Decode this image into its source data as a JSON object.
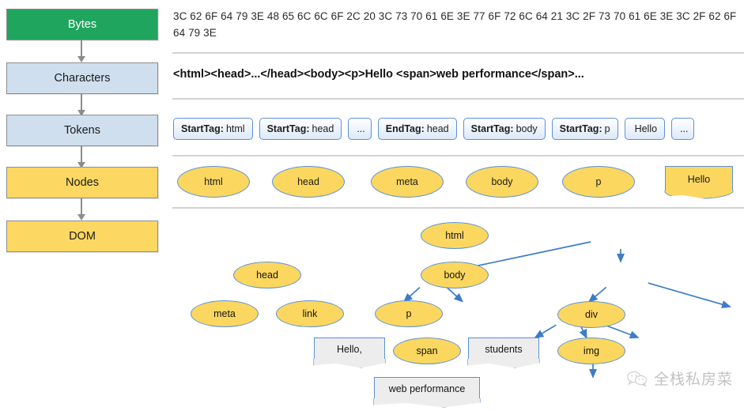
{
  "pipeline": {
    "steps": [
      {
        "label": "Bytes",
        "color": "#1fa55d",
        "style": "green"
      },
      {
        "label": "Characters",
        "color": "#cfdfee",
        "style": "blue"
      },
      {
        "label": "Tokens",
        "color": "#cfdfee",
        "style": "blue"
      },
      {
        "label": "Nodes",
        "color": "#fcd862",
        "style": "yellow"
      },
      {
        "label": "DOM",
        "color": "#fcd862",
        "style": "yellow"
      }
    ]
  },
  "stages": {
    "bytes": {
      "text": "3C 62 6F 64 79 3E 48 65 6C 6C 6F 2C 20 3C 73 70 61 6E 3E 77 6F 72 6C 64 21 3C 2F 73 70 61 6E 3E 3C 2F 62 6F 64 79 3E"
    },
    "characters": {
      "text": "<html><head>...</head><body><p>Hello <span>web performance</span>..."
    },
    "tokens": {
      "items": [
        {
          "key": "StartTag:",
          "value": "html"
        },
        {
          "key": "StartTag:",
          "value": "head"
        },
        {
          "key": "",
          "value": "..."
        },
        {
          "key": "EndTag:",
          "value": "head"
        },
        {
          "key": "StartTag:",
          "value": "body"
        },
        {
          "key": "StartTag:",
          "value": "p"
        },
        {
          "key": "",
          "value": "Hello"
        },
        {
          "key": "",
          "value": "..."
        }
      ]
    },
    "nodes": {
      "items": [
        {
          "label": "html",
          "shape": "ellipse"
        },
        {
          "label": "head",
          "shape": "ellipse"
        },
        {
          "label": "meta",
          "shape": "ellipse"
        },
        {
          "label": "body",
          "shape": "ellipse"
        },
        {
          "label": "p",
          "shape": "ellipse"
        },
        {
          "label": "Hello",
          "shape": "note"
        }
      ]
    },
    "dom_tree": {
      "element_nodes": [
        {
          "id": "html",
          "label": "html"
        },
        {
          "id": "head",
          "label": "head"
        },
        {
          "id": "body",
          "label": "body"
        },
        {
          "id": "meta",
          "label": "meta"
        },
        {
          "id": "link",
          "label": "link"
        },
        {
          "id": "p",
          "label": "p"
        },
        {
          "id": "div",
          "label": "div"
        },
        {
          "id": "span",
          "label": "span"
        },
        {
          "id": "img",
          "label": "img"
        }
      ],
      "text_nodes": [
        {
          "id": "hello",
          "label": "Hello,"
        },
        {
          "id": "students",
          "label": "students"
        },
        {
          "id": "webperf",
          "label": "web performance"
        }
      ],
      "edges": [
        {
          "from": "html",
          "to": "head"
        },
        {
          "from": "html",
          "to": "body"
        },
        {
          "from": "head",
          "to": "meta"
        },
        {
          "from": "head",
          "to": "link"
        },
        {
          "from": "body",
          "to": "p"
        },
        {
          "from": "body",
          "to": "div"
        },
        {
          "from": "p",
          "to": "hello"
        },
        {
          "from": "p",
          "to": "span"
        },
        {
          "from": "p",
          "to": "students"
        },
        {
          "from": "span",
          "to": "webperf"
        },
        {
          "from": "div",
          "to": "img"
        }
      ]
    }
  },
  "watermark": {
    "text": "全栈私房菜",
    "icon": "wechat-icon"
  },
  "colors": {
    "node_fill": "#fbd75f",
    "node_border": "#5a92d8",
    "text_node_fill": "#ededed",
    "stage_divider": "#d2d2d2",
    "flow_arrow": "#8c8c8c"
  }
}
